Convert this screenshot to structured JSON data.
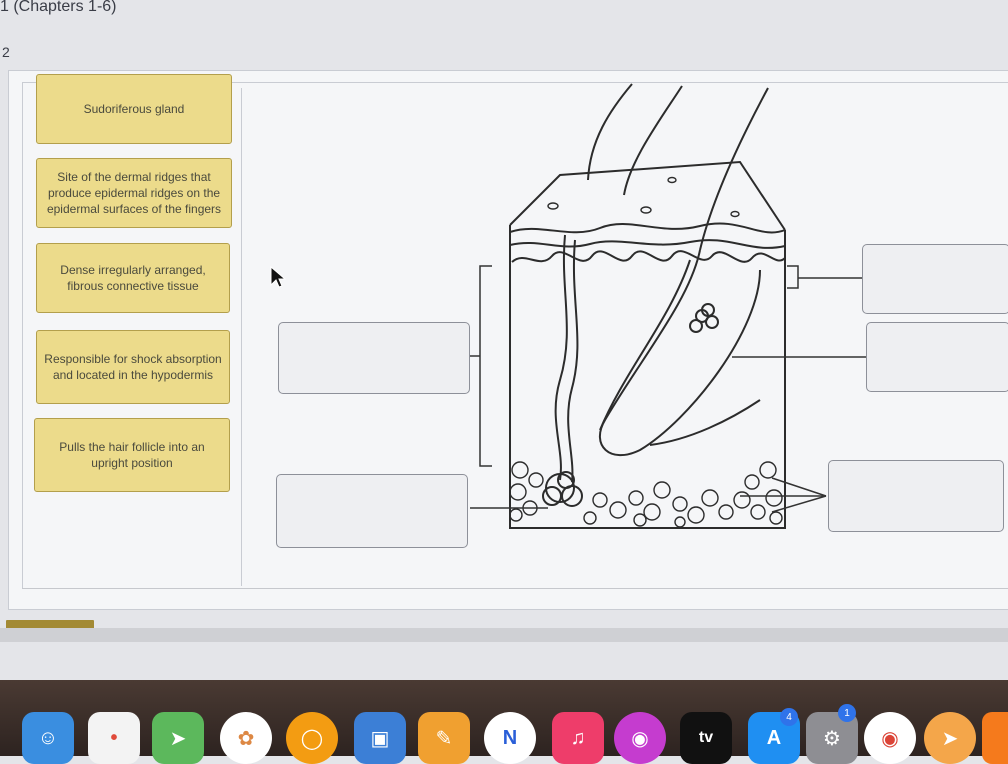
{
  "header": {
    "title": "1 (Chapters 1-6)",
    "question_number": "2"
  },
  "labels": [
    "Sudoriferous gland",
    "Site of the dermal ridges that produce epidermal ridges on the epidermal surfaces of the fingers",
    "Dense irregularly arranged, fibrous connective tissue",
    "Responsible for shock absorption and located in the hypodermis",
    "Pulls the hair follicle into an upright position"
  ],
  "dock": {
    "tv_label": "tv",
    "badge_app_store": "4",
    "badge_settings": "1"
  },
  "colors": {
    "label_fill": "#ecdb8b",
    "label_border": "#b39f4c",
    "dock": "#3b2e29"
  }
}
